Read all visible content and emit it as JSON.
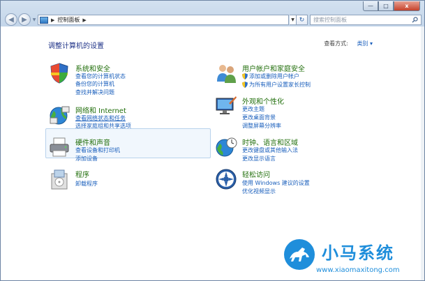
{
  "address": {
    "path": [
      "控制面板"
    ],
    "search_placeholder": "搜索控制面板"
  },
  "window_controls": {
    "minimize": "—",
    "maximize": "□",
    "close": "x"
  },
  "content": {
    "heading": "调整计算机的设置",
    "view_by_label": "查看方式:",
    "view_by_value": "类别 ▾"
  },
  "categories": {
    "system": {
      "title": "系统和安全",
      "links": [
        "查看您的计算机状态",
        "备份您的计算机",
        "查找并解决问题"
      ]
    },
    "network": {
      "title": "网络和 Internet",
      "links": [
        "查看网络状态和任务",
        "选择家庭组和共享选项"
      ]
    },
    "hardware": {
      "title": "硬件和声音",
      "links": [
        "查看设备和打印机",
        "添加设备"
      ]
    },
    "programs": {
      "title": "程序",
      "links": [
        "卸载程序"
      ]
    },
    "users": {
      "title": "用户帐户和家庭安全",
      "links": [
        "添加或删除用户帐户",
        "为所有用户设置家长控制"
      ]
    },
    "appearance": {
      "title": "外观和个性化",
      "links": [
        "更改主题",
        "更改桌面背景",
        "调整屏幕分辨率"
      ]
    },
    "clock": {
      "title": "时钟、语言和区域",
      "links": [
        "更改键盘或其他输入法",
        "更改显示语言"
      ]
    },
    "ease": {
      "title": "轻松访问",
      "links": [
        "使用 Windows 建议的设置",
        "优化视频显示"
      ]
    }
  },
  "watermark": {
    "title": "小马系统",
    "url": "www.xiaomaxitong.com"
  },
  "colors": {
    "category_title": "#226f0c",
    "link": "#1a5fbc",
    "heading": "#1e3287",
    "watermark": "#1f8edb"
  }
}
